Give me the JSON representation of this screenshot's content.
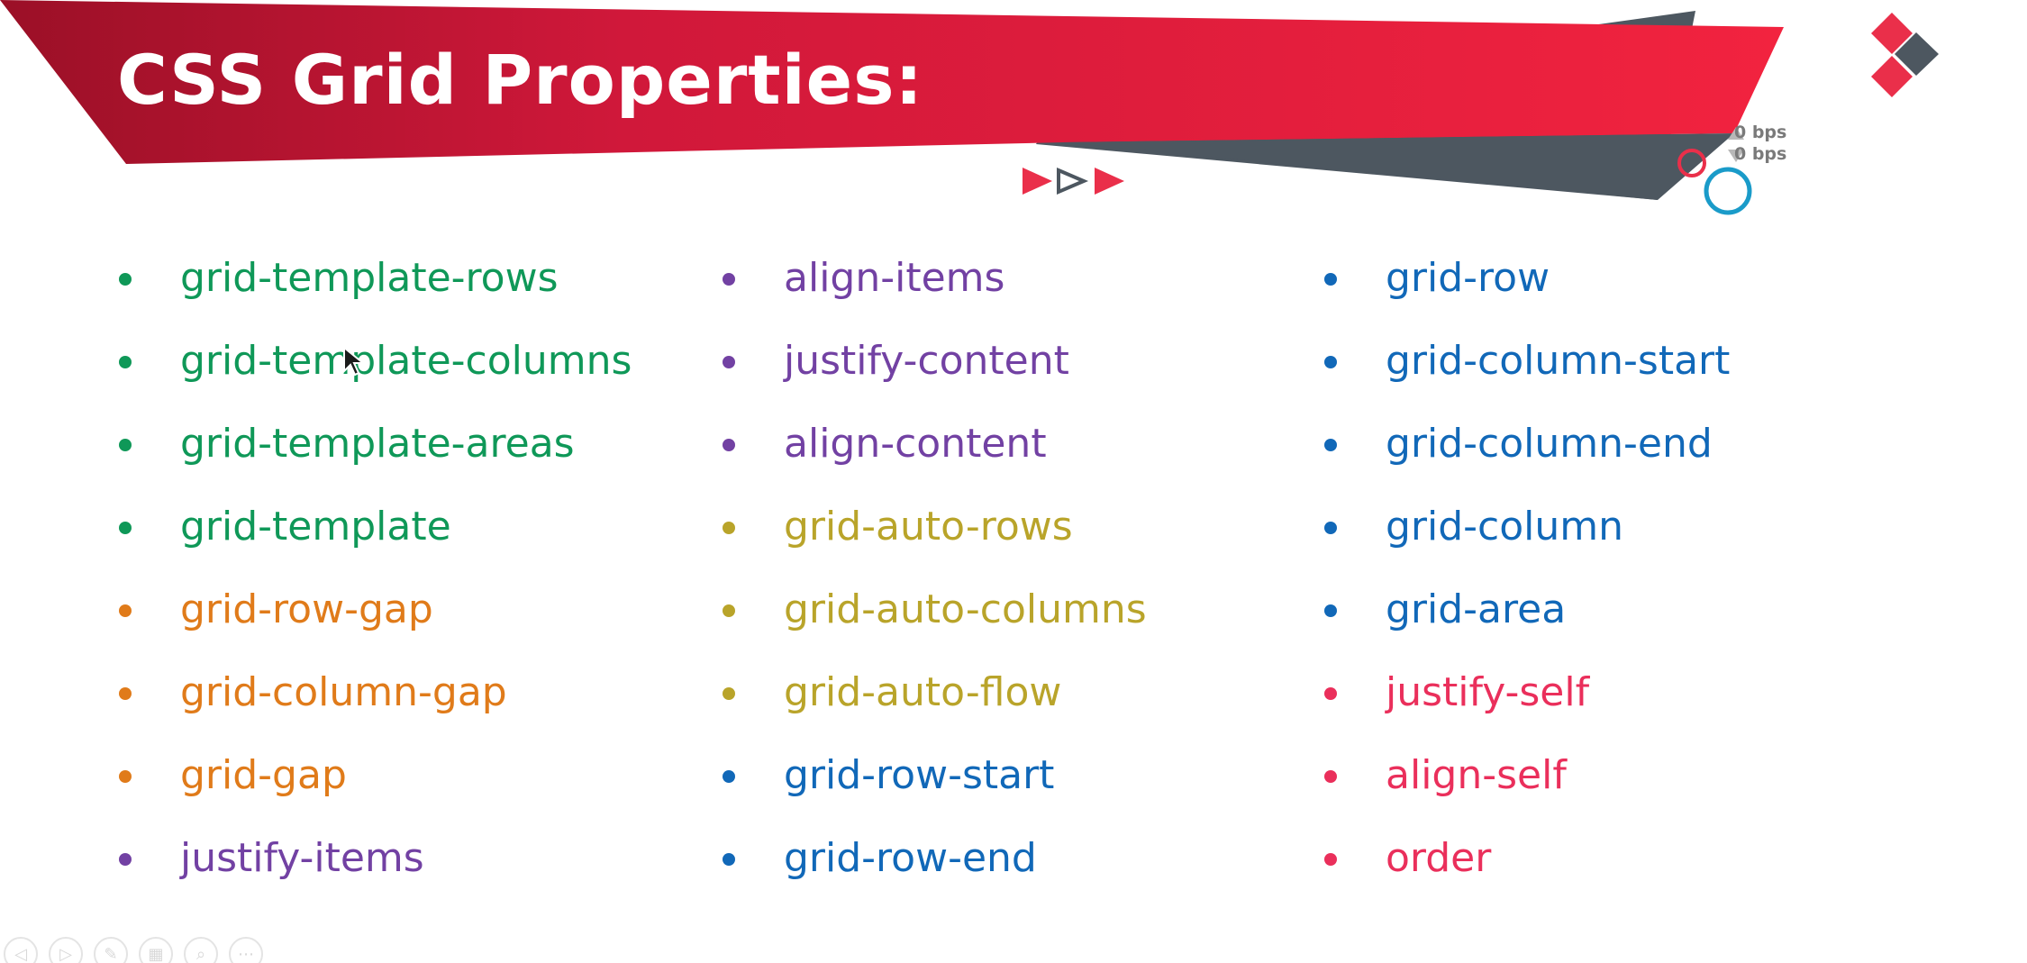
{
  "slide": {
    "title": "CSS Grid Properties:",
    "colors": {
      "banner_red": "#e8203f",
      "banner_dark_red": "#a3122b",
      "banner_gray": "#4d5760",
      "accent_blue": "#1a9bc9"
    }
  },
  "overlay": {
    "upload_rate": "0 bps",
    "download_rate": "0 bps"
  },
  "columns": [
    {
      "items": [
        {
          "label": "grid-template-rows",
          "color": "#0f9858"
        },
        {
          "label": "grid-template-columns",
          "color": "#0f9858"
        },
        {
          "label": "grid-template-areas",
          "color": "#0f9858"
        },
        {
          "label": "grid-template",
          "color": "#0f9858"
        },
        {
          "label": "grid-row-gap",
          "color": "#e07b1a"
        },
        {
          "label": "grid-column-gap",
          "color": "#e07b1a"
        },
        {
          "label": "grid-gap",
          "color": "#e07b1a"
        },
        {
          "label": "justify-items",
          "color": "#7241a3"
        }
      ]
    },
    {
      "items": [
        {
          "label": "align-items",
          "color": "#7241a3"
        },
        {
          "label": "justify-content",
          "color": "#7241a3"
        },
        {
          "label": "align-content",
          "color": "#7241a3"
        },
        {
          "label": "grid-auto-rows",
          "color": "#b9a42a"
        },
        {
          "label": "grid-auto-columns",
          "color": "#b9a42a"
        },
        {
          "label": "grid-auto-flow",
          "color": "#b9a42a"
        },
        {
          "label": "grid-row-start",
          "color": "#1168b8"
        },
        {
          "label": "grid-row-end",
          "color": "#1168b8"
        }
      ]
    },
    {
      "items": [
        {
          "label": "grid-row",
          "color": "#1168b8"
        },
        {
          "label": "grid-column-start",
          "color": "#1168b8"
        },
        {
          "label": "grid-column-end",
          "color": "#1168b8"
        },
        {
          "label": "grid-column",
          "color": "#1168b8"
        },
        {
          "label": "grid-area",
          "color": "#1168b8"
        },
        {
          "label": "justify-self",
          "color": "#ea2f5b"
        },
        {
          "label": "align-self",
          "color": "#ea2f5b"
        },
        {
          "label": "order",
          "color": "#ea2f5b"
        }
      ]
    }
  ],
  "toolbar": {
    "buttons": [
      {
        "icon": "previous-icon"
      },
      {
        "icon": "next-icon"
      },
      {
        "icon": "pen-icon"
      },
      {
        "icon": "slides-icon"
      },
      {
        "icon": "zoom-icon"
      },
      {
        "icon": "more-icon"
      }
    ]
  }
}
